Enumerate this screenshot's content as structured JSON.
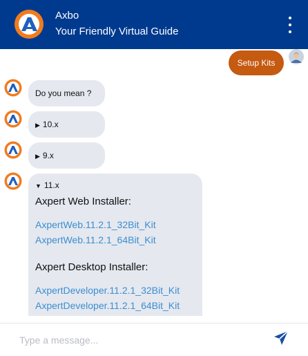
{
  "header": {
    "bot_name": "Axbo",
    "subtitle": "Your Friendly Virtual Guide",
    "menu_icon": "kebab-menu-icon",
    "brand_color": "#003a8f",
    "logo_color": "#f07c1e"
  },
  "messages": {
    "user_message": "Setup Kits",
    "user_bubble_color": "#c55a11",
    "bot_prompt": "Do you mean ?",
    "options": [
      {
        "label": "10.x",
        "expanded": false
      },
      {
        "label": "9.x",
        "expanded": false
      },
      {
        "label": "11.x",
        "expanded": true
      }
    ],
    "expanded": {
      "web_title": "Axpert Web Installer:",
      "web_links": [
        "AxpertWeb.11.2.1_32Bit_Kit",
        "AxpertWeb.11.2.1_64Bit_Kit"
      ],
      "desktop_title": "Axpert Desktop Installer:",
      "desktop_links": [
        "AxpertDeveloper.11.2.1_32Bit_Kit",
        "AxpertDeveloper.11.2.1_64Bit_Kit"
      ]
    }
  },
  "composer": {
    "placeholder": "Type a message...",
    "send_icon": "send-icon"
  }
}
